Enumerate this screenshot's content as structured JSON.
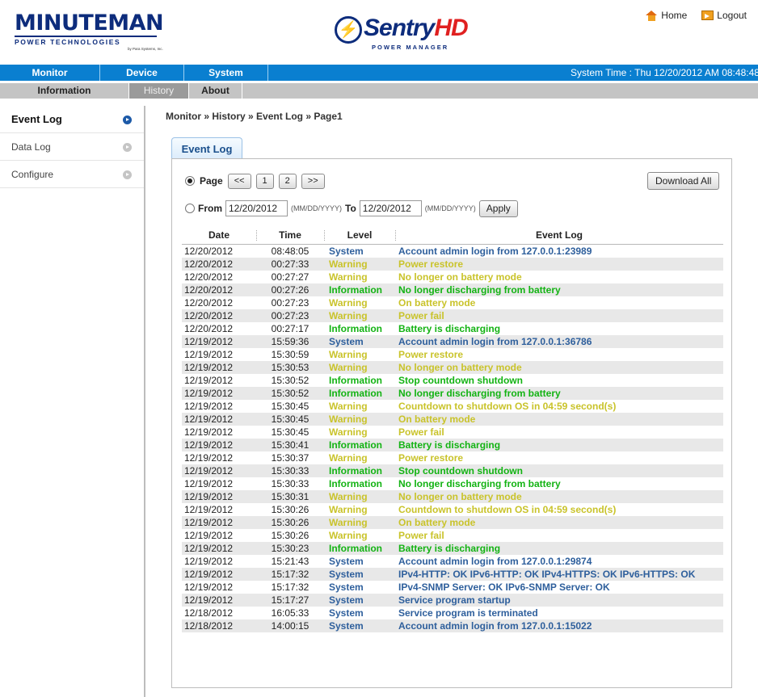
{
  "header": {
    "logo_brand": "MINUTEMAN",
    "logo_tagline": "POWER TECHNOLOGIES",
    "logo_sub": "by Para Systems, Inc.",
    "product_name": "Sentry",
    "product_suffix": "HD",
    "product_tagline": "POWER MANAGER",
    "home_label": "Home",
    "logout_label": "Logout"
  },
  "mainnav": {
    "items": [
      "Monitor",
      "Device",
      "System"
    ],
    "system_time": "System Time : Thu 12/20/2012 AM 08:48:48"
  },
  "subnav": {
    "items": [
      "Information",
      "History",
      "About"
    ],
    "active": "History"
  },
  "sidebar": {
    "items": [
      {
        "label": "Event Log",
        "active": true
      },
      {
        "label": "Data Log",
        "active": false
      },
      {
        "label": "Configure",
        "active": false
      }
    ]
  },
  "breadcrumb": "Monitor » History » Event Log  » Page1",
  "tab_label": "Event Log",
  "pager": {
    "page_label": "Page",
    "buttons": [
      "<<",
      "1",
      "2",
      ">>"
    ],
    "download_label": "Download All"
  },
  "range": {
    "from_label": "From",
    "from_value": "12/20/2012",
    "format_hint_1": "(MM/DD/YYYY)",
    "to_label": "To",
    "to_value": "12/20/2012",
    "format_hint_2": "(MM/DD/YYYY)",
    "apply_label": "Apply"
  },
  "colors": {
    "System": "#2e5f9c",
    "Warning": "#c9c32a",
    "Information": "#13b313"
  },
  "table": {
    "columns": [
      "Date",
      "Time",
      "Level",
      "Event Log"
    ],
    "rows": [
      [
        "12/20/2012",
        "08:48:05",
        "System",
        "Account admin login from 127.0.0.1:23989"
      ],
      [
        "12/20/2012",
        "00:27:33",
        "Warning",
        "Power restore"
      ],
      [
        "12/20/2012",
        "00:27:27",
        "Warning",
        "No longer on battery mode"
      ],
      [
        "12/20/2012",
        "00:27:26",
        "Information",
        "No longer discharging from battery"
      ],
      [
        "12/20/2012",
        "00:27:23",
        "Warning",
        "On battery mode"
      ],
      [
        "12/20/2012",
        "00:27:23",
        "Warning",
        "Power fail"
      ],
      [
        "12/20/2012",
        "00:27:17",
        "Information",
        "Battery is discharging"
      ],
      [
        "12/19/2012",
        "15:59:36",
        "System",
        "Account admin login from 127.0.0.1:36786"
      ],
      [
        "12/19/2012",
        "15:30:59",
        "Warning",
        "Power restore"
      ],
      [
        "12/19/2012",
        "15:30:53",
        "Warning",
        "No longer on battery mode"
      ],
      [
        "12/19/2012",
        "15:30:52",
        "Information",
        "Stop countdown shutdown"
      ],
      [
        "12/19/2012",
        "15:30:52",
        "Information",
        "No longer discharging from battery"
      ],
      [
        "12/19/2012",
        "15:30:45",
        "Warning",
        "Countdown to shutdown OS in 04:59 second(s)"
      ],
      [
        "12/19/2012",
        "15:30:45",
        "Warning",
        "On battery mode"
      ],
      [
        "12/19/2012",
        "15:30:45",
        "Warning",
        "Power fail"
      ],
      [
        "12/19/2012",
        "15:30:41",
        "Information",
        "Battery is discharging"
      ],
      [
        "12/19/2012",
        "15:30:37",
        "Warning",
        "Power restore"
      ],
      [
        "12/19/2012",
        "15:30:33",
        "Information",
        "Stop countdown shutdown"
      ],
      [
        "12/19/2012",
        "15:30:33",
        "Information",
        "No longer discharging from battery"
      ],
      [
        "12/19/2012",
        "15:30:31",
        "Warning",
        "No longer on battery mode"
      ],
      [
        "12/19/2012",
        "15:30:26",
        "Warning",
        "Countdown to shutdown OS in 04:59 second(s)"
      ],
      [
        "12/19/2012",
        "15:30:26",
        "Warning",
        "On battery mode"
      ],
      [
        "12/19/2012",
        "15:30:26",
        "Warning",
        "Power fail"
      ],
      [
        "12/19/2012",
        "15:30:23",
        "Information",
        "Battery is discharging"
      ],
      [
        "12/19/2012",
        "15:21:43",
        "System",
        "Account admin login from 127.0.0.1:29874"
      ],
      [
        "12/19/2012",
        "15:17:32",
        "System",
        "IPv4-HTTP: OK IPv6-HTTP: OK IPv4-HTTPS: OK IPv6-HTTPS: OK"
      ],
      [
        "12/19/2012",
        "15:17:32",
        "System",
        "IPv4-SNMP Server: OK IPv6-SNMP Server: OK"
      ],
      [
        "12/19/2012",
        "15:17:27",
        "System",
        "Service program startup"
      ],
      [
        "12/18/2012",
        "16:05:33",
        "System",
        "Service program is terminated"
      ],
      [
        "12/18/2012",
        "14:00:15",
        "System",
        "Account admin login from 127.0.0.1:15022"
      ]
    ]
  }
}
